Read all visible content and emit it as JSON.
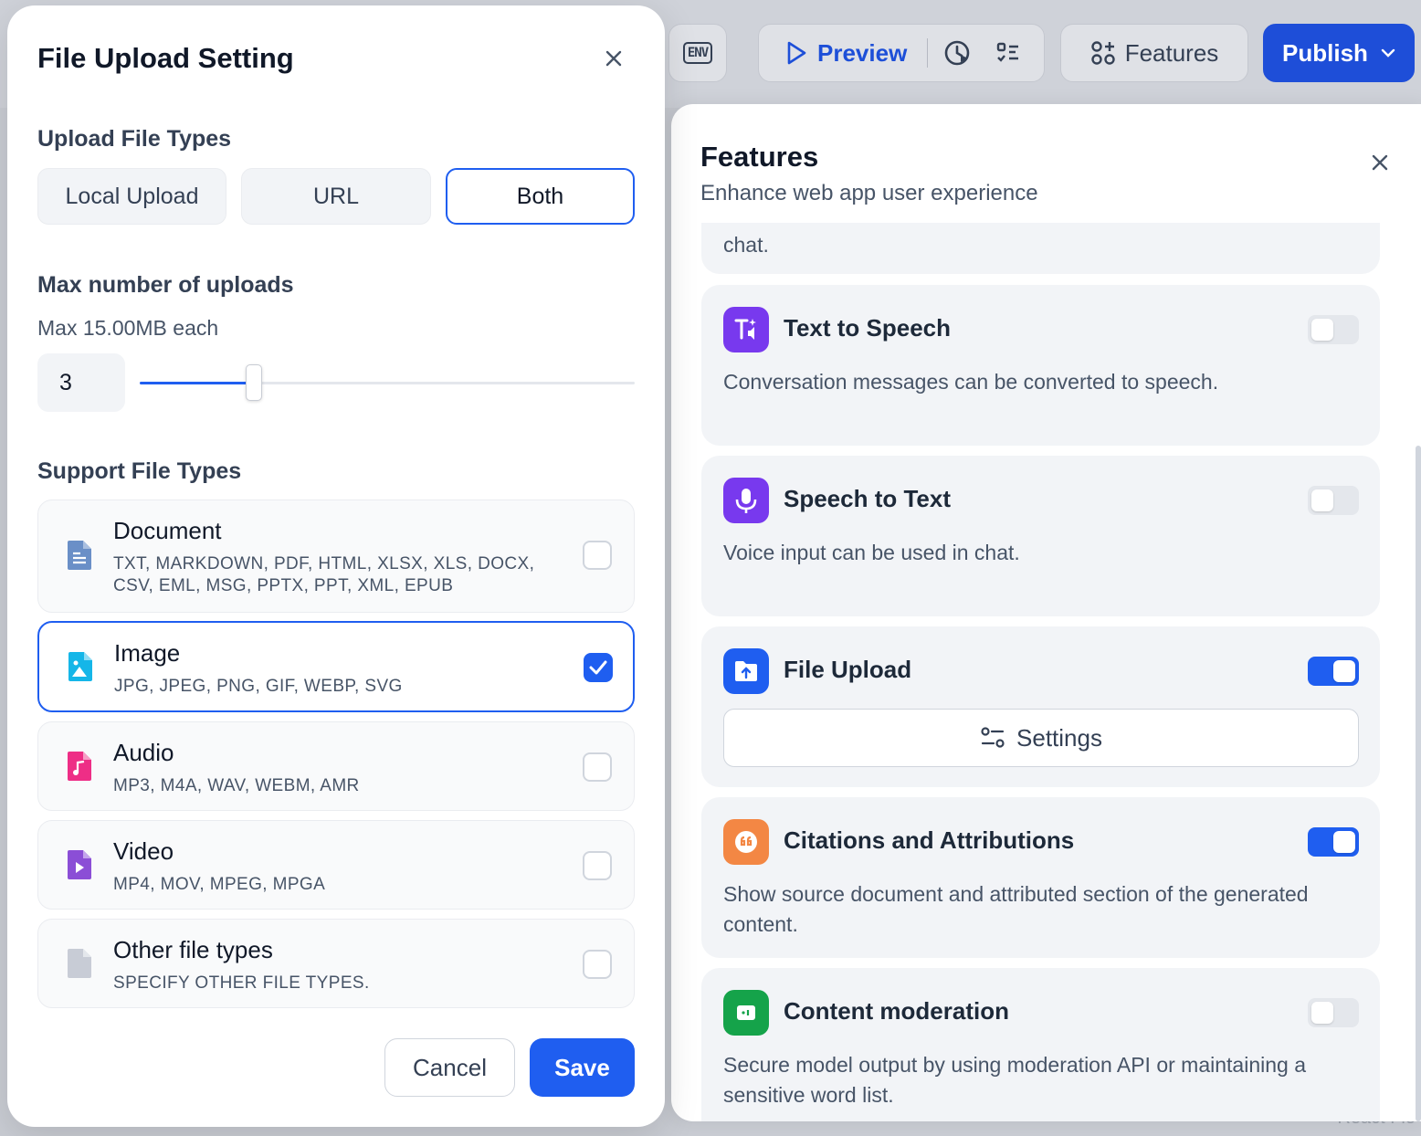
{
  "toolbar": {
    "env_label": "ENV",
    "preview_label": "Preview",
    "features_label": "Features",
    "publish_label": "Publish"
  },
  "features_panel": {
    "title": "Features",
    "subtitle": "Enhance web app user experience",
    "partial_text": "chat.",
    "cards": {
      "tts": {
        "title": "Text to Speech",
        "desc": "Conversation messages can be converted to speech.",
        "enabled": false,
        "icon": "text-to-speech-icon",
        "color": "#7839ee"
      },
      "stt": {
        "title": "Speech to Text",
        "desc": "Voice input can be used in chat.",
        "enabled": false,
        "icon": "microphone-icon",
        "color": "#7839ee"
      },
      "upload": {
        "title": "File Upload",
        "settings_label": "Settings",
        "enabled": true,
        "icon": "folder-upload-icon",
        "color": "#1f5ef0"
      },
      "citations": {
        "title": "Citations and Attributions",
        "desc": "Show source document and attributed section of the generated content.",
        "enabled": true,
        "icon": "quote-icon",
        "color": "#f38744"
      },
      "moderation": {
        "title": "Content moderation",
        "desc": "Secure model output by using moderation API or maintaining a sensitive word list.",
        "enabled": false,
        "icon": "moderation-icon",
        "color": "#15a34a"
      }
    }
  },
  "modal": {
    "title": "File Upload Setting",
    "upload_types_label": "Upload File Types",
    "upload_types": [
      "Local Upload",
      "URL",
      "Both"
    ],
    "upload_types_selected": "Both",
    "max_uploads_label": "Max number of uploads",
    "max_uploads_sub": "Max 15.00MB each",
    "max_uploads_value": "3",
    "slider_fraction": 0.23,
    "support_types_label": "Support File Types",
    "file_types": [
      {
        "name": "Document",
        "exts": "TXT, MARKDOWN, PDF, HTML, XLSX, XLS, DOCX, CSV, EML, MSG, PPTX, PPT, XML, EPUB",
        "checked": false,
        "icon": "document-icon",
        "color": "#6a8fc7"
      },
      {
        "name": "Image",
        "exts": "JPG, JPEG, PNG, GIF, WEBP, SVG",
        "checked": true,
        "icon": "image-icon",
        "color": "#15b6e8"
      },
      {
        "name": "Audio",
        "exts": "MP3, M4A, WAV, WEBM, AMR",
        "checked": false,
        "icon": "audio-icon",
        "color": "#ee2e86"
      },
      {
        "name": "Video",
        "exts": "MP4, MOV, MPEG, MPGA",
        "checked": false,
        "icon": "video-icon",
        "color": "#8b4ed6"
      },
      {
        "name": "Other file types",
        "exts": "SPECIFY OTHER FILE TYPES.",
        "checked": false,
        "icon": "file-icon",
        "color": "#c8ccd6"
      }
    ],
    "cancel_label": "Cancel",
    "save_label": "Save"
  },
  "background": {
    "bottom_text": "React Flo"
  }
}
